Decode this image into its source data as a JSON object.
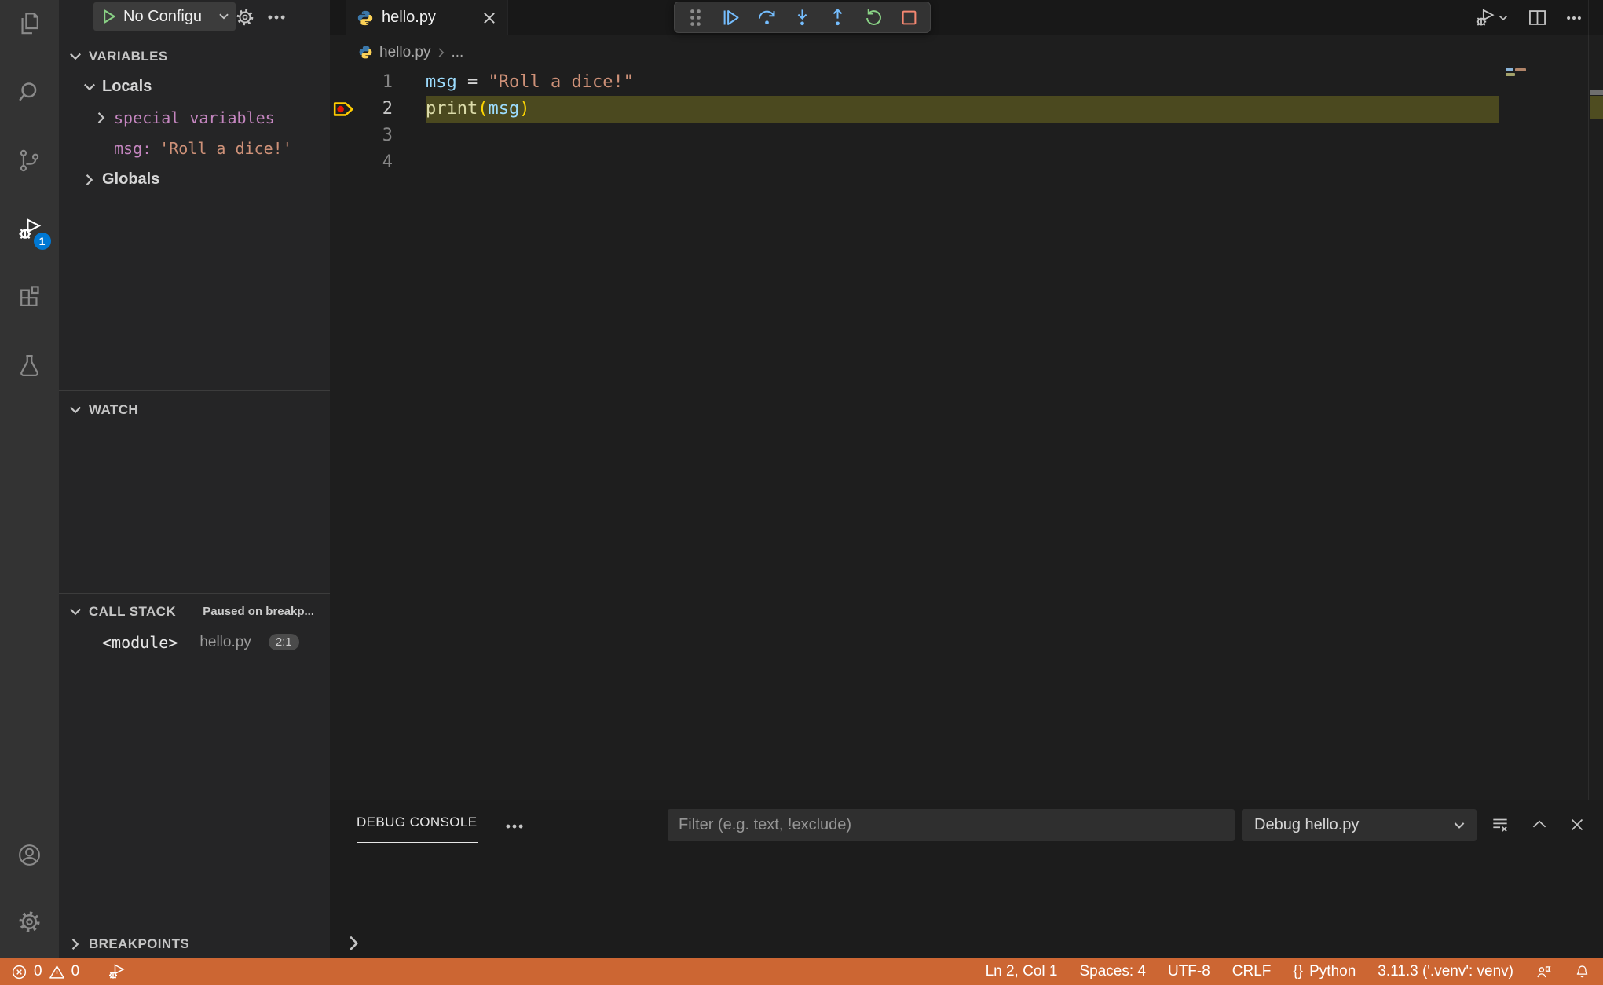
{
  "activity_bar": {
    "debug_badge": "1"
  },
  "sidebar": {
    "toolbar": {
      "config_label": "No Configu"
    },
    "variables": {
      "title": "VARIABLES",
      "locals_label": "Locals",
      "special_label": "special variables",
      "msg_label": "msg:",
      "msg_value": "'Roll a dice!'",
      "globals_label": "Globals"
    },
    "watch": {
      "title": "WATCH"
    },
    "call_stack": {
      "title": "CALL STACK",
      "status": "Paused on breakp...",
      "frame_name": "<module>",
      "frame_file": "hello.py",
      "frame_pos": "2:1"
    },
    "breakpoints": {
      "title": "BREAKPOINTS"
    }
  },
  "editor": {
    "tab_label": "hello.py",
    "breadcrumb_file": "hello.py",
    "breadcrumb_more": "...",
    "lines": [
      {
        "number": "1",
        "tokens": [
          "msg",
          " = ",
          "\"Roll a dice!\""
        ]
      },
      {
        "number": "2",
        "tokens": [
          "print",
          "(",
          "msg",
          ")"
        ]
      },
      {
        "number": "3",
        "tokens": []
      },
      {
        "number": "4",
        "tokens": []
      }
    ]
  },
  "panel": {
    "tab_label": "DEBUG CONSOLE",
    "filter_placeholder": "Filter (e.g. text, !exclude)",
    "session_label": "Debug hello.py"
  },
  "status_bar": {
    "errors": "0",
    "warnings": "0",
    "cursor": "Ln 2, Col 1",
    "indent": "Spaces: 4",
    "encoding": "UTF-8",
    "eol": "CRLF",
    "lang_icon": "{}",
    "language": "Python",
    "interpreter": "3.11.3 ('.venv': venv)"
  },
  "colors": {
    "status_bar_debugging": "#CC6633",
    "badge_blue": "#0078D4",
    "debug_step_blue": "#75BEFF",
    "debug_restart_green": "#89D185",
    "debug_stop_red": "#F48771",
    "token_variable": "#9CDCFE",
    "token_string": "#CE9178",
    "token_function": "#DCDCAA",
    "token_bracket": "#FFD700",
    "token_special": "#C586C0",
    "stackframe_line_highlight": "#4B491F",
    "breakpoint_red": "#E51400",
    "stackframe_arrow_yellow": "#FFCC00"
  }
}
